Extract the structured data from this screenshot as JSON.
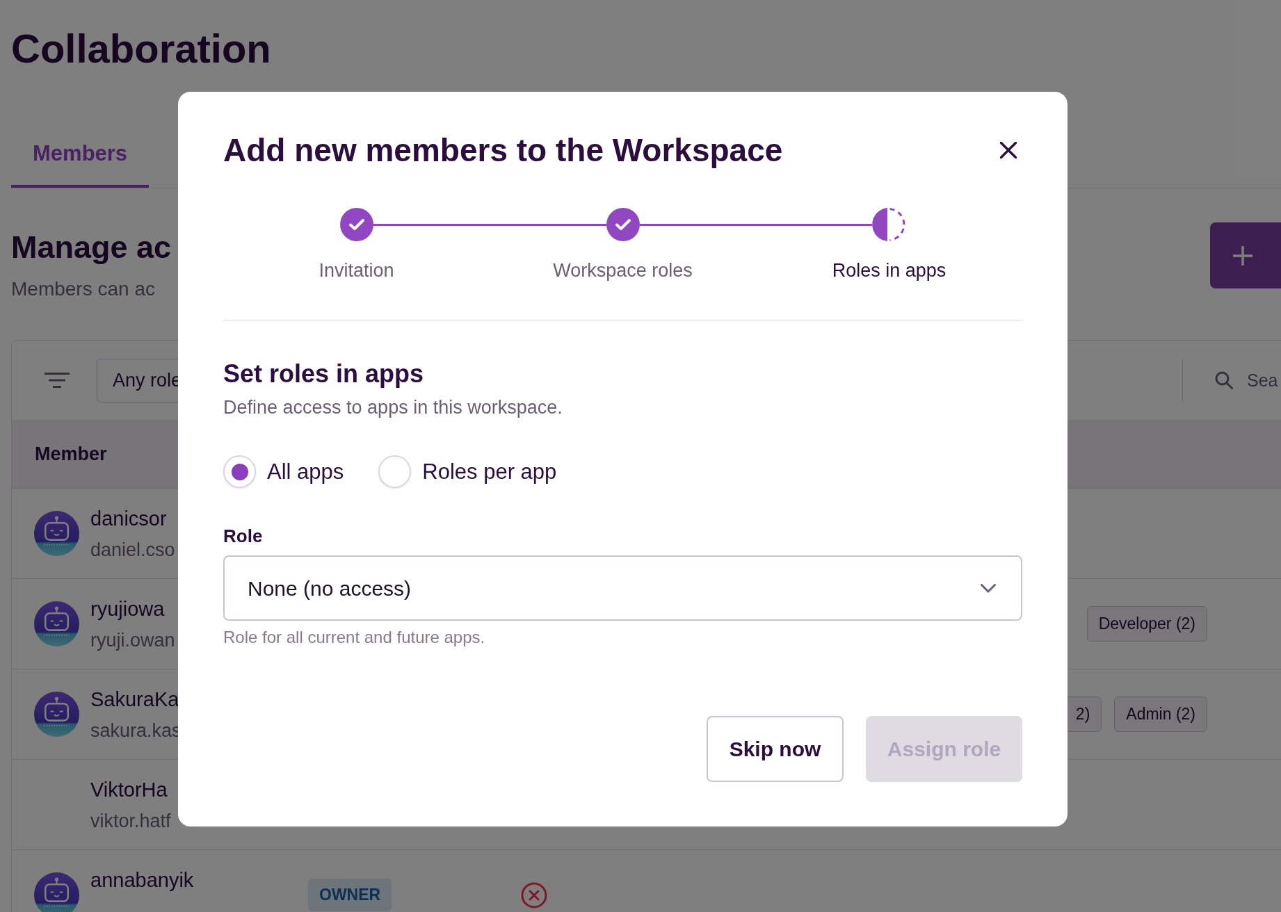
{
  "page": {
    "title": "Collaboration",
    "tabs": [
      {
        "label": "Members",
        "selected": true
      }
    ],
    "heading": "Manage ac",
    "subheading": "Members can ac"
  },
  "members_table": {
    "role_filter": "Any role",
    "search": {
      "placeholder": "Sea"
    },
    "columns": [
      "Member"
    ],
    "rows": [
      {
        "name": "danicsor",
        "email": "daniel.cso",
        "avatar": true
      },
      {
        "name": "ryujiowa",
        "email": "ryuji.owan",
        "avatar": true,
        "app_roles": [
          "Developer (2)"
        ]
      },
      {
        "name": "SakuraKa",
        "email": "sakura.kas",
        "avatar": true,
        "app_roles": [
          "2)",
          "Admin (2)"
        ]
      },
      {
        "name": "ViktorHa",
        "email": "viktor.hatf",
        "avatar": false
      },
      {
        "name": "annabanyik",
        "avatar": true,
        "workspace_role": "OWNER",
        "no_access": true
      }
    ]
  },
  "dialog": {
    "title": "Add new members to the Workspace",
    "steps": [
      {
        "label": "Invitation",
        "completed": true,
        "active": false
      },
      {
        "label": "Workspace roles",
        "completed": true,
        "active": false
      },
      {
        "label": "Roles in apps",
        "completed": false,
        "active": true
      }
    ],
    "section_title": "Set roles in apps",
    "section_description": "Define access to apps in this workspace.",
    "scope_options": [
      {
        "label": "All apps",
        "selected": true
      },
      {
        "label": "Roles per app",
        "selected": false
      }
    ],
    "role_field": {
      "label": "Role",
      "value": "None (no access)",
      "hint": "Role for all current and future apps."
    },
    "buttons": [
      {
        "label": "Skip now",
        "kind": "secondary",
        "disabled": false
      },
      {
        "label": "Assign role",
        "kind": "primary",
        "disabled": true
      }
    ]
  }
}
